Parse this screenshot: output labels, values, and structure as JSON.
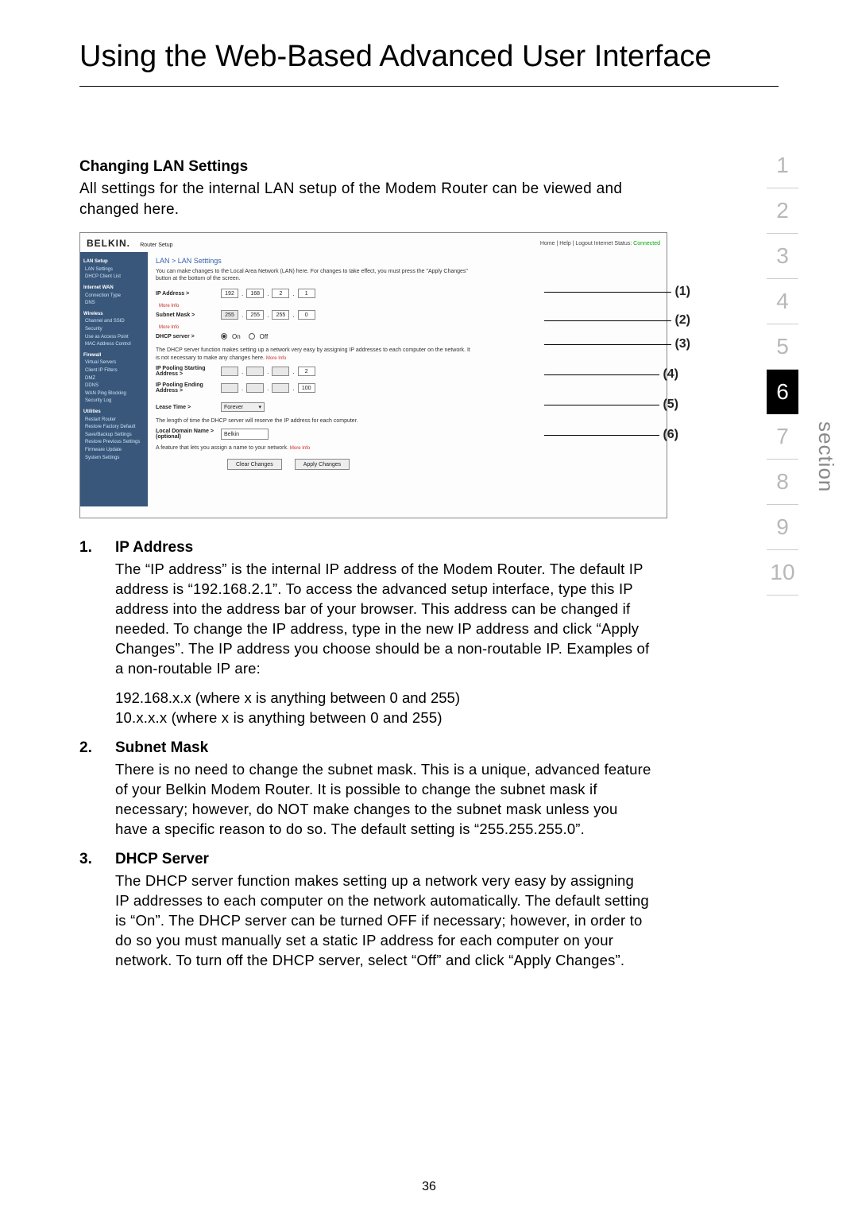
{
  "page_title": "Using the Web-Based Advanced User Interface",
  "section": {
    "heading": "Changing LAN Settings",
    "intro": "All settings for the internal LAN setup of the Modem Router can be viewed and changed here."
  },
  "screenshot": {
    "brand": "BELKIN.",
    "header_right_text": "Router Setup",
    "linkbar": "Home | Help | Logout   Internet Status:",
    "linkbar_status": "Connected",
    "sidebar": {
      "groups": [
        {
          "head": "LAN Setup",
          "items": [
            "LAN Settings",
            "DHCP Client List"
          ]
        },
        {
          "head": "Internet WAN",
          "items": [
            "Connection Type",
            "DNS"
          ]
        },
        {
          "head": "Wireless",
          "items": [
            "Channel and SSID",
            "Security",
            "Use as Access Point",
            "MAC Address Control"
          ]
        },
        {
          "head": "Firewall",
          "items": [
            "Virtual Servers",
            "Client IP Filters",
            "DMZ",
            "DDNS",
            "WAN Ping Blocking",
            "Security Log"
          ]
        },
        {
          "head": "Utilities",
          "items": [
            "Restart Router",
            "Restore Factory Default",
            "Save/Backup Settings",
            "Restore Previous Settings",
            "Firmware Update",
            "System Settings"
          ]
        }
      ]
    },
    "breadcrumb": "LAN > LAN Setttings",
    "desc": "You can make changes to the Local Area Network (LAN) here. For changes to take effect, you must press the \"Apply Changes\" button at the bottom of the screen.",
    "rows": {
      "ip_label": "IP Address >",
      "ip": [
        "192",
        "168",
        "2",
        "1"
      ],
      "more_info": "More Info",
      "mask_label": "Subnet Mask >",
      "mask": [
        "255",
        "255",
        "255",
        "0"
      ],
      "dhcp_label": "DHCP server >",
      "dhcp_on": "On",
      "dhcp_off": "Off",
      "dhcp_desc": "The DHCP server function makes setting up a network very easy by assigning IP addresses to each computer on the network. It is not necessary to make any changes here.",
      "pool_start_label": "IP Pooling Starting Address >",
      "pool_start": [
        "",
        "",
        "",
        "2"
      ],
      "pool_end_label": "IP Pooling Ending Address >",
      "pool_end": [
        "",
        "",
        "",
        "100"
      ],
      "lease_label": "Lease Time >",
      "lease_value": "Forever",
      "lease_desc": "The length of time the DHCP server will reserve the IP address for each computer.",
      "domain_label": "Local Domain Name > (optional)",
      "domain_value": "Belkin",
      "domain_desc": "A feature that lets you assign a name to your network."
    },
    "buttons": {
      "clear": "Clear Changes",
      "apply": "Apply Changes"
    },
    "callouts": [
      "(1)",
      "(2)",
      "(3)",
      "(4)",
      "(5)",
      "(6)"
    ]
  },
  "items": [
    {
      "num": "1.",
      "title": "IP Address",
      "body": "The “IP address” is the internal IP address of the Modem Router. The default IP address is “192.168.2.1”. To access the advanced setup interface, type this IP address into the address bar of your browser. This address can be changed if needed. To change the IP address, type in the new IP address and click “Apply Changes”. The IP address you choose should be a non-routable IP. Examples of a non-routable IP are:",
      "extra1": "192.168.x.x (where x is anything between 0 and 255)",
      "extra2": "10.x.x.x (where x is anything between 0 and 255)"
    },
    {
      "num": "2.",
      "title": "Subnet Mask",
      "body": "There is no need to change the subnet mask. This is a unique, advanced feature of your Belkin Modem Router. It is possible to change the subnet mask if necessary; however, do NOT make changes to the subnet mask unless you have a specific reason to do so. The default setting is “255.255.255.0”."
    },
    {
      "num": "3.",
      "title": "DHCP Server",
      "body": "The DHCP server function makes setting up a network very easy by assigning IP addresses to each computer on the network automatically. The default setting is “On”. The DHCP server can be turned OFF if necessary; however, in order to do so you must manually set a static IP address for each computer on your network. To turn off the DHCP server, select “Off” and click “Apply Changes”."
    }
  ],
  "section_nav": {
    "label": "section",
    "numbers": [
      "1",
      "2",
      "3",
      "4",
      "5",
      "6",
      "7",
      "8",
      "9",
      "10"
    ],
    "active": "6"
  },
  "page_number": "36"
}
